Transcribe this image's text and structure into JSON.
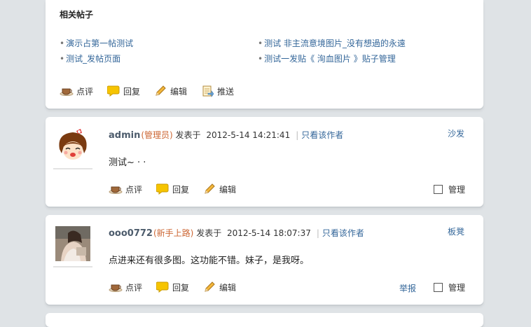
{
  "related": {
    "title": "相关帖子",
    "items": [
      "演示占第一帖测试",
      "测试  非主流意境图片_没有想過的永遠",
      "测试_发帖页面",
      "测试一发贴《  洵血图片 》贴子管理"
    ],
    "actions": {
      "review": "点评",
      "reply": "回复",
      "edit": "编辑",
      "push": "推送"
    }
  },
  "posts": [
    {
      "author": "admin",
      "role": "(管理员)",
      "posted_prefix": "发表于",
      "time": "2012-5-14 14:21:41",
      "only_author": "只看该作者",
      "floor": "沙发",
      "content": "测试~ · ·",
      "actions": {
        "review": "点评",
        "reply": "回复",
        "edit": "编辑"
      },
      "manage": "管理"
    },
    {
      "author": "ooo0772",
      "role": "(新手上路)",
      "posted_prefix": "发表于",
      "time": "2012-5-14 18:07:37",
      "only_author": "只看该作者",
      "floor": "板凳",
      "content": "点进来还有很多图。这功能不错。妹子，是我呀。",
      "actions": {
        "review": "点评",
        "reply": "回复",
        "edit": "编辑"
      },
      "report": "举报",
      "manage": "管理"
    }
  ],
  "colors": {
    "page_bg": "#dfe3e6",
    "link": "#336699",
    "role": "#cc6633"
  }
}
